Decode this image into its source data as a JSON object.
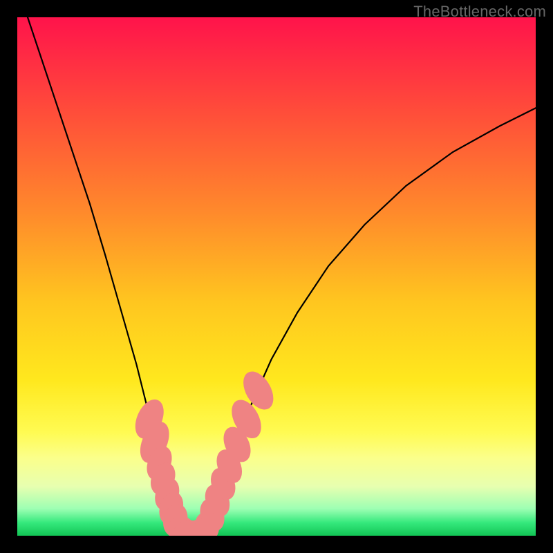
{
  "watermark": "TheBottleneck.com",
  "chart_data": {
    "type": "line",
    "title": "",
    "xlabel": "",
    "ylabel": "",
    "xlim": [
      0,
      100
    ],
    "ylim": [
      0,
      100
    ],
    "gradient_stops": [
      {
        "offset": 0,
        "color": "#ff134b"
      },
      {
        "offset": 0.18,
        "color": "#ff4c3a"
      },
      {
        "offset": 0.38,
        "color": "#ff8b2b"
      },
      {
        "offset": 0.55,
        "color": "#ffc61f"
      },
      {
        "offset": 0.7,
        "color": "#ffe81e"
      },
      {
        "offset": 0.8,
        "color": "#fffb52"
      },
      {
        "offset": 0.85,
        "color": "#fbff8b"
      },
      {
        "offset": 0.905,
        "color": "#e7ffb0"
      },
      {
        "offset": 0.948,
        "color": "#9dffb3"
      },
      {
        "offset": 0.975,
        "color": "#35e97c"
      },
      {
        "offset": 1.0,
        "color": "#12c455"
      }
    ],
    "series": [
      {
        "name": "left-branch",
        "x": [
          2,
          6,
          10,
          14,
          17,
          19,
          21,
          23,
          24.5,
          26,
          27.3,
          28.3,
          29.2,
          30,
          30.7,
          31.3
        ],
        "y": [
          100,
          88,
          76,
          64,
          54,
          47,
          40,
          33,
          27,
          21,
          15.5,
          10.5,
          6.5,
          3.5,
          1.5,
          0.5
        ]
      },
      {
        "name": "valley-floor",
        "x": [
          31.3,
          33,
          34.7,
          36.0
        ],
        "y": [
          0.5,
          0.2,
          0.2,
          0.5
        ]
      },
      {
        "name": "right-branch",
        "x": [
          36.0,
          37.3,
          38.7,
          40.3,
          42.3,
          45,
          49,
          54,
          60,
          67,
          75,
          84,
          93,
          100
        ],
        "y": [
          0.5,
          3,
          7,
          12,
          18,
          25,
          34,
          43,
          52,
          60,
          67.5,
          74,
          79,
          82.5
        ]
      }
    ],
    "markers": [
      {
        "x": 25.5,
        "y": 22.5,
        "rx": 2.4,
        "ry": 4.0,
        "rot": 24
      },
      {
        "x": 26.5,
        "y": 18.0,
        "rx": 2.4,
        "ry": 4.2,
        "rot": 24
      },
      {
        "x": 27.4,
        "y": 14.0,
        "rx": 2.2,
        "ry": 3.4,
        "rot": 22
      },
      {
        "x": 28.1,
        "y": 11.0,
        "rx": 2.2,
        "ry": 3.2,
        "rot": 22
      },
      {
        "x": 28.9,
        "y": 8.0,
        "rx": 2.2,
        "ry": 3.2,
        "rot": 20
      },
      {
        "x": 29.7,
        "y": 5.3,
        "rx": 2.2,
        "ry": 3.2,
        "rot": 18
      },
      {
        "x": 30.5,
        "y": 3.0,
        "rx": 2.3,
        "ry": 3.2,
        "rot": 14
      },
      {
        "x": 31.6,
        "y": 1.2,
        "rx": 2.6,
        "ry": 2.6,
        "rot": 0
      },
      {
        "x": 33.2,
        "y": 0.6,
        "rx": 3.0,
        "ry": 2.4,
        "rot": 0
      },
      {
        "x": 35.0,
        "y": 0.7,
        "rx": 2.8,
        "ry": 2.4,
        "rot": 0
      },
      {
        "x": 36.6,
        "y": 1.8,
        "rx": 2.3,
        "ry": 2.8,
        "rot": -14
      },
      {
        "x": 37.6,
        "y": 4.0,
        "rx": 2.2,
        "ry": 3.2,
        "rot": -20
      },
      {
        "x": 38.6,
        "y": 6.8,
        "rx": 2.2,
        "ry": 3.2,
        "rot": -22
      },
      {
        "x": 39.7,
        "y": 10.0,
        "rx": 2.2,
        "ry": 3.2,
        "rot": -22
      },
      {
        "x": 40.9,
        "y": 13.4,
        "rx": 2.2,
        "ry": 3.4,
        "rot": -24
      },
      {
        "x": 42.4,
        "y": 17.6,
        "rx": 2.3,
        "ry": 3.6,
        "rot": -26
      },
      {
        "x": 44.2,
        "y": 22.5,
        "rx": 2.4,
        "ry": 4.0,
        "rot": -28
      },
      {
        "x": 46.5,
        "y": 28.0,
        "rx": 2.4,
        "ry": 4.0,
        "rot": -30
      }
    ]
  }
}
